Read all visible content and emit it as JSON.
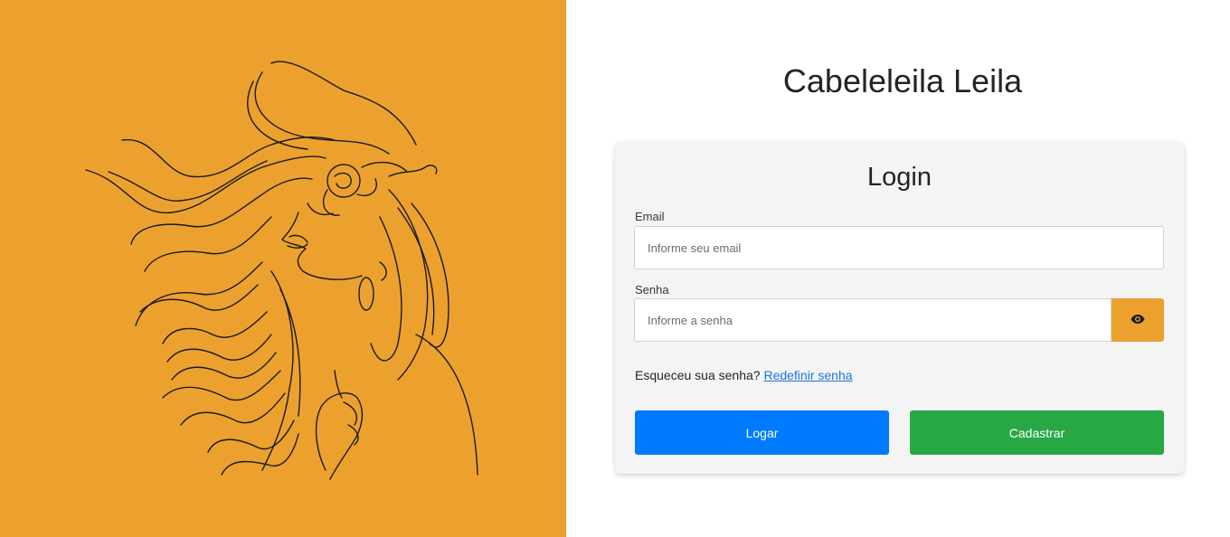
{
  "app": {
    "title": "Cabeleleila Leila"
  },
  "colors": {
    "accent": "#eca12f",
    "login_button": "#007bff",
    "register_button": "#28a745",
    "card_background": "#f4f4f4",
    "link": "#1a73e8"
  },
  "illustration": {
    "icon": "woman-hair-line-art-illustration"
  },
  "login_card": {
    "title": "Login",
    "email": {
      "label": "Email",
      "value": "",
      "placeholder": "Informe seu email"
    },
    "password": {
      "label": "Senha",
      "value": "",
      "placeholder": "Informe a senha",
      "toggle_icon": "eye-icon"
    },
    "forgot": {
      "text": "Esqueceu sua senha?",
      "link_label": "Redefinir senha"
    },
    "buttons": {
      "login_label": "Logar",
      "register_label": "Cadastrar"
    }
  }
}
